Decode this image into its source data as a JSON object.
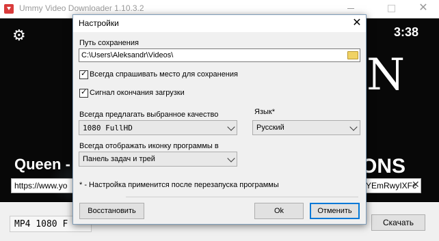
{
  "main_window": {
    "title": "Ummy Video Downloader 1.10.3.2",
    "close_glyph": "✕",
    "duration": "3:38",
    "background_letters": "N",
    "background_letters_bottom": "ONS",
    "video_title": "Queen - V",
    "url_start": "https://www.yo",
    "url_end": "YEmRwyIXFc",
    "url_clear_glyph": "✕",
    "format_value": "MP4  1080 F",
    "download_label": "Скачать",
    "settings_icon": "gear-icon",
    "app_icon": "download-icon"
  },
  "dialog": {
    "title": "Настройки",
    "close_glyph": "✕",
    "save_path_label": "Путь сохранения",
    "save_path_value": "C:\\Users\\Aleksandr\\Videos\\",
    "always_ask_label": "Всегда спрашивать место для сохранения",
    "always_ask_checked": true,
    "sound_label": "Сигнал окончания загрузки",
    "sound_checked": true,
    "quality_label": "Всегда предлагать выбранное качество",
    "quality_value": "1080 FullHD",
    "language_label": "Язык*",
    "language_value": "Русский",
    "tray_label": "Всегда отображать иконку программы в",
    "tray_value": "Панель задач и трей",
    "note": "* - Настройка применится после перезапуска программы",
    "restore_label": "Восстановить",
    "ok_label": "Ok",
    "cancel_label": "Отменить"
  },
  "colors": {
    "dialog_bg": "#f0f0f0",
    "primary_border": "#0078d7",
    "app_icon": "#d93b3b"
  }
}
